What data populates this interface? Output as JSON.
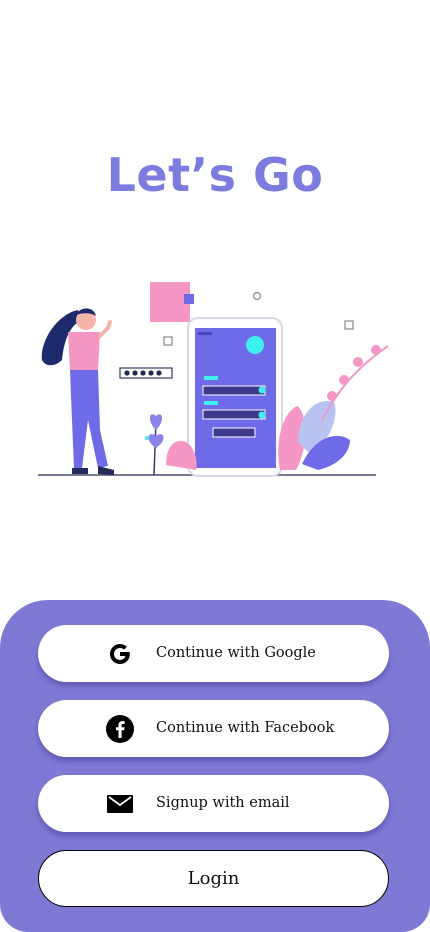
{
  "title": "Let’s Go",
  "colors": {
    "title": "#7b7be0",
    "panel": "#7f79d6",
    "button_bg": "#ffffff"
  },
  "buttons": {
    "google": {
      "label": "Continue with Google",
      "icon": "google-icon"
    },
    "facebook": {
      "label": "Continue with Facebook",
      "icon": "facebook-icon"
    },
    "email": {
      "label": "Signup with email",
      "icon": "mail-icon"
    },
    "login": {
      "label": "Login"
    }
  },
  "illustration": {
    "icon": "login-illustration"
  }
}
